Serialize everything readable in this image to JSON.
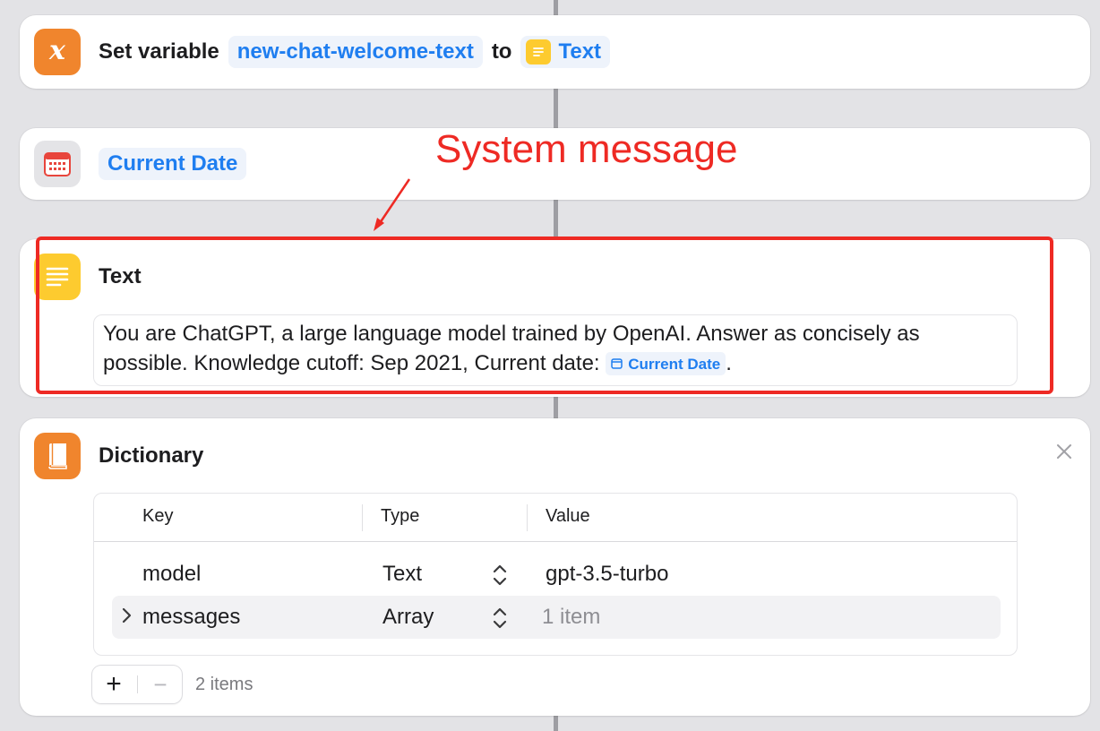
{
  "set_variable_action": {
    "label": "Set variable",
    "variable_name": "new-chat-welcome-text",
    "to_label": "to",
    "value_token": "Text",
    "icon": "x-variable-icon"
  },
  "current_date_action": {
    "token": "Current Date",
    "icon": "calendar-icon"
  },
  "annotation": {
    "text": "System message",
    "color": "#ee2a24"
  },
  "text_action": {
    "title": "Text",
    "content_before": "You are ChatGPT, a large language model trained by OpenAI. Answer as concisely as possible. Knowledge cutoff:  Sep 2021, Current date:",
    "content_token": "Current Date",
    "content_after": ".",
    "icon": "text-lines-icon"
  },
  "dictionary_action": {
    "title": "Dictionary",
    "icon": "book-icon",
    "columns": [
      "Key",
      "Type",
      "Value"
    ],
    "rows": [
      {
        "key": "model",
        "type": "Text",
        "value": "gpt-3.5-turbo"
      },
      {
        "key": "messages",
        "type": "Array",
        "value": "1 item"
      }
    ],
    "add_label": "+",
    "remove_label": "−",
    "items_count": "2 items"
  },
  "colors": {
    "accent": "#1f7ef0",
    "orange": "#f0852d",
    "yellow": "#fdcb2f",
    "highlight": "#ee2a24"
  }
}
